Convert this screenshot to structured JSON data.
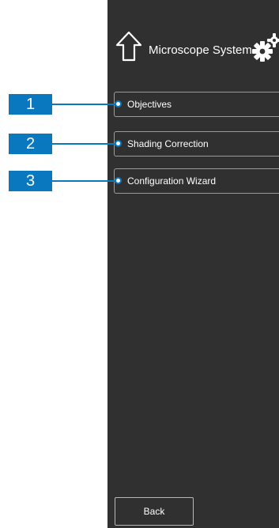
{
  "header": {
    "title": "Microscope System",
    "home_icon": "home-icon",
    "settings_icon": "gear-icon"
  },
  "menu": {
    "items": [
      {
        "label": "Objectives",
        "callout": "1"
      },
      {
        "label": "Shading Correction",
        "callout": "2"
      },
      {
        "label": "Configuration Wizard",
        "callout": "3"
      }
    ]
  },
  "footer": {
    "back_label": "Back"
  },
  "colors": {
    "panel_background": "#303030",
    "callout_blue": "#0a78be",
    "text": "#ffffff",
    "border": "#9b9b9b"
  }
}
